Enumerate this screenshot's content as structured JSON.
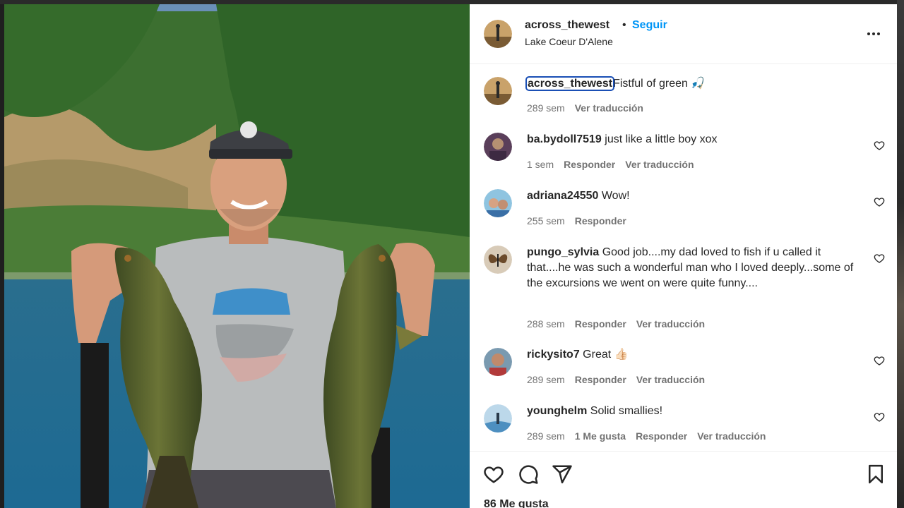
{
  "post": {
    "username": "across_thewest",
    "separator": "•",
    "follow_label": "Seguir",
    "location": "Lake Coeur D'Alene",
    "more_icon": "more-horizontal-icon"
  },
  "caption": {
    "username": "across_thewest",
    "text": "Fistful of green 🎣",
    "time": "289 sem",
    "translate": "Ver traducción"
  },
  "comments": [
    {
      "username": "ba.bydoll7519",
      "text": "just like a little boy xox",
      "time": "1 sem",
      "likes": "",
      "reply": "Responder",
      "translate": "Ver traducción"
    },
    {
      "username": "adriana24550",
      "text": "Wow!",
      "time": "255 sem",
      "likes": "",
      "reply": "Responder",
      "translate": ""
    },
    {
      "username": "pungo_sylvia",
      "text": "Good job....my dad loved to fish if u called it that....he was such a wonderful man who I loved deeply...some of the excursions we went on were quite funny....",
      "time": "288 sem",
      "likes": "",
      "reply": "Responder",
      "translate": "Ver traducción"
    },
    {
      "username": "rickysito7",
      "text": "Great 👍🏻",
      "time": "289 sem",
      "likes": "",
      "reply": "Responder",
      "translate": "Ver traducción"
    },
    {
      "username": "younghelm",
      "text": "Solid smallies!",
      "time": "289 sem",
      "likes": "1 Me gusta",
      "reply": "Responder",
      "translate": "Ver traducción"
    }
  ],
  "actions": {
    "like_icon": "heart-icon",
    "comment_icon": "comment-icon",
    "share_icon": "send-icon",
    "save_icon": "bookmark-icon",
    "likes_count": "86 Me gusta"
  },
  "colors": {
    "link_blue": "#0095f6",
    "text": "#262626",
    "secondary": "#737373",
    "focus_outline": "#1a4fb5"
  }
}
